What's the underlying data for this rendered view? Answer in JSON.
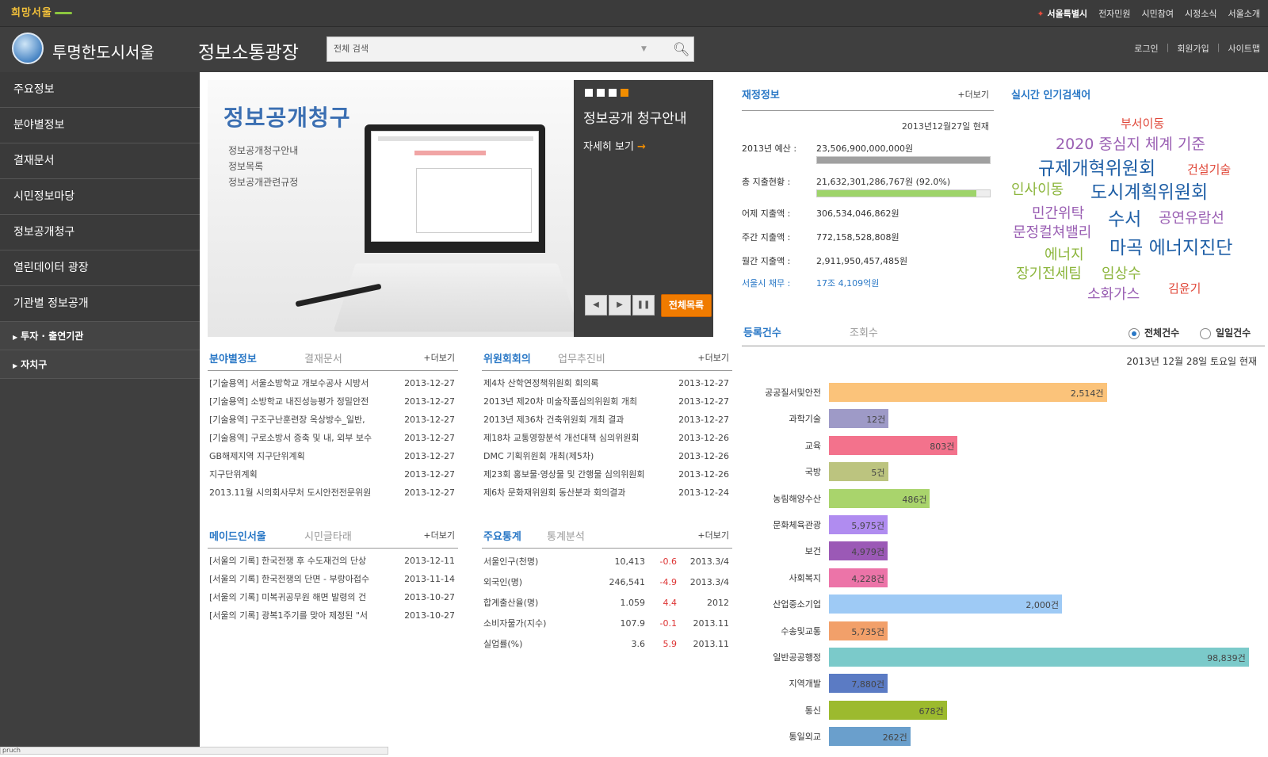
{
  "topbar": {
    "logo": "희망서울",
    "brand_pre": "서울특별시",
    "links": [
      "전자민원",
      "시민참여",
      "시정소식",
      "서울소개"
    ]
  },
  "header": {
    "site_title": "투명한도시서울",
    "section_title": "정보소통광장",
    "search_placeholder": "전체 검색",
    "user_links": [
      "로그인",
      "회원가입",
      "사이트맵"
    ]
  },
  "sidebar": {
    "items": [
      "주요정보",
      "분야별정보",
      "결재문서",
      "시민정보마당",
      "정보공개청구",
      "열린데이터 광장",
      "기관별 정보공개"
    ],
    "subitems": [
      "투자 · 출연기관",
      "자치구"
    ]
  },
  "banner": {
    "heading": "정보공개청구",
    "lines": [
      "정보공개청구안내",
      "정보목록",
      "정보공개관련규정"
    ],
    "side_title": "정보공개 청구안내",
    "side_more": "자세히 보기",
    "list_all": "전체목록"
  },
  "field_info": {
    "tab_on": "분야별정보",
    "tab_off": "결재문서",
    "more": "+더보기",
    "rows": [
      {
        "title": "[기술용역] 서울소방학교 개보수공사 시방서",
        "date": "2013-12-27"
      },
      {
        "title": "[기술용역] 소방학교 내진성능평가 정밀안전",
        "date": "2013-12-27"
      },
      {
        "title": "[기술용역] 구조구난훈련장 옥상방수_일반,",
        "date": "2013-12-27"
      },
      {
        "title": "[기술용역] 구로소방서 증축 및 내, 외부 보수",
        "date": "2013-12-27"
      },
      {
        "title": "GB해제지역 지구단위계획",
        "date": "2013-12-27"
      },
      {
        "title": "지구단위계획",
        "date": "2013-12-27"
      },
      {
        "title": "2013.11월 시의회사무처 도시안전전문위원",
        "date": "2013-12-27"
      }
    ]
  },
  "committee": {
    "tab_on": "위원회회의",
    "tab_off": "업무추진비",
    "more": "+더보기",
    "rows": [
      {
        "title": "제4차 산학연정책위원회 회의록",
        "date": "2013-12-27"
      },
      {
        "title": "2013년 제20차 미술작품심의위원회 개최",
        "date": "2013-12-27"
      },
      {
        "title": "2013년 제36차 건축위원회 개최 결과",
        "date": "2013-12-27"
      },
      {
        "title": "제18차 교통영향분석 개선대책 심의위원회",
        "date": "2013-12-26"
      },
      {
        "title": "DMC 기획위원회 개최(제5차)",
        "date": "2013-12-26"
      },
      {
        "title": "제23회 홍보물·영상물 및 간행물 심의위원회",
        "date": "2013-12-26"
      },
      {
        "title": "제6차 문화재위원회 동산분과 회의결과",
        "date": "2013-12-24"
      }
    ]
  },
  "made_in_seoul": {
    "tab_on": "메이드인서울",
    "tab_off": "시민글타래",
    "more": "+더보기",
    "rows": [
      {
        "title": "[서울의 기록] 한국전쟁 후 수도재건의 단상",
        "date": "2013-12-11"
      },
      {
        "title": "[서울의 기록] 한국전쟁의 단면 - 부랑아접수",
        "date": "2013-11-14"
      },
      {
        "title": "[서울의 기록] 미복귀공무원 해면 발령의 건",
        "date": "2013-10-27"
      },
      {
        "title": "[서울의 기록] 광복1주기를 맞아 제정된 \"서",
        "date": "2013-10-27"
      }
    ]
  },
  "stats": {
    "tab_on": "주요통계",
    "tab_off": "통계분석",
    "more": "+더보기",
    "rows": [
      {
        "name": "서울인구(천명)",
        "value": "10,413",
        "change": "-0.6",
        "period": "2013.3/4"
      },
      {
        "name": "외국인(명)",
        "value": "246,541",
        "change": "-4.9",
        "period": "2013.3/4"
      },
      {
        "name": "합계출산율(명)",
        "value": "1.059",
        "change": "4.4",
        "period": "2012"
      },
      {
        "name": "소비자물가(지수)",
        "value": "107.9",
        "change": "-0.1",
        "period": "2013.11"
      },
      {
        "name": "실업률(%)",
        "value": "3.6",
        "change": "5.9",
        "period": "2013.11"
      }
    ]
  },
  "finance": {
    "head": "재정정보",
    "more": "+더보기",
    "date": "2013년12월27일 현재",
    "rows": [
      {
        "label": "2013년 예산 :",
        "value": "23,506,900,000,000원",
        "bar": 1.0,
        "bar_color": "#a0a0a0"
      },
      {
        "label": "총 지출현황 :",
        "value": "21,632,301,286,767원 (92.0%)",
        "bar": 0.92,
        "bar_color": "#9ed46a"
      },
      {
        "label": "어제 지출액 :",
        "value": "306,534,046,862원"
      },
      {
        "label": "주간 지출액 :",
        "value": "772,158,528,808원"
      },
      {
        "label": "월간 지출액 :",
        "value": "2,911,950,457,485원"
      },
      {
        "label": "서울시 채무 :",
        "value": "17조 4,109억원",
        "blue": true
      }
    ]
  },
  "keywords": {
    "head": "실시간 인기검색어",
    "words": [
      {
        "text": "부서이동",
        "color": "#e0483a",
        "size": 15
      },
      {
        "text": "2020 중심지 체계 기준",
        "color": "#9a5fb3",
        "size": 19
      },
      {
        "text": "규제개혁위원회",
        "color": "#1f5fa6",
        "size": 23
      },
      {
        "text": "건설기술",
        "color": "#e0483a",
        "size": 15
      },
      {
        "text": "인사이동",
        "color": "#8db63e",
        "size": 18
      },
      {
        "text": "도시계획위원회",
        "color": "#1f5fa6",
        "size": 23
      },
      {
        "text": "민간위탁",
        "color": "#9a5fb3",
        "size": 18
      },
      {
        "text": "수서",
        "color": "#1f5fa6",
        "size": 23
      },
      {
        "text": "공연유람선",
        "color": "#9a5fb3",
        "size": 18
      },
      {
        "text": "문정컬쳐밸리",
        "color": "#9a5fb3",
        "size": 18
      },
      {
        "text": "마곡 에너지진단",
        "color": "#1f5fa6",
        "size": 23
      },
      {
        "text": "에너지",
        "color": "#8db63e",
        "size": 18
      },
      {
        "text": "장기전세팀",
        "color": "#8db63e",
        "size": 18
      },
      {
        "text": "임상수",
        "color": "#8db63e",
        "size": 18
      },
      {
        "text": "소화가스",
        "color": "#9a5fb3",
        "size": 18
      },
      {
        "text": "김윤기",
        "color": "#e0483a",
        "size": 15
      }
    ]
  },
  "registration": {
    "tab_on": "등록건수",
    "tab_off": "조회수",
    "radio_all": "전체건수",
    "radio_daily": "일일건수",
    "date": "2013년 12월 28일 토요일 현재"
  },
  "chart_data": {
    "type": "bar",
    "orientation": "horizontal",
    "xlim": [
      0,
      100000
    ],
    "categories": [
      "공공질서및안전",
      "과학기술",
      "교육",
      "국방",
      "농림해양수산",
      "문화체육관광",
      "보건",
      "사회복지",
      "산업중소기업",
      "수송및교통",
      "일반공공행정",
      "지역개발",
      "통신",
      "통일외교"
    ],
    "values": [
      2514,
      12,
      803,
      5,
      486,
      5975,
      4979,
      4228,
      2000,
      5735,
      98839,
      7880,
      678,
      262
    ],
    "labels": [
      "2,514건",
      "12건",
      "803건",
      "5건",
      "486건",
      "5,975건",
      "4,979건",
      "4,228건",
      "2,000건",
      "5,735건",
      "98,839건",
      "7,880건",
      "678건",
      "262건"
    ],
    "colors": [
      "#fbc37a",
      "#9e9ac7",
      "#f3728c",
      "#bcc47f",
      "#a9d46c",
      "#b08cf0",
      "#9b59b6",
      "#ec74a8",
      "#9ecaf5",
      "#f2a06a",
      "#7bcaca",
      "#5b7bc4",
      "#9cba2e",
      "#6a9fcc"
    ]
  },
  "status_text": "pruch"
}
